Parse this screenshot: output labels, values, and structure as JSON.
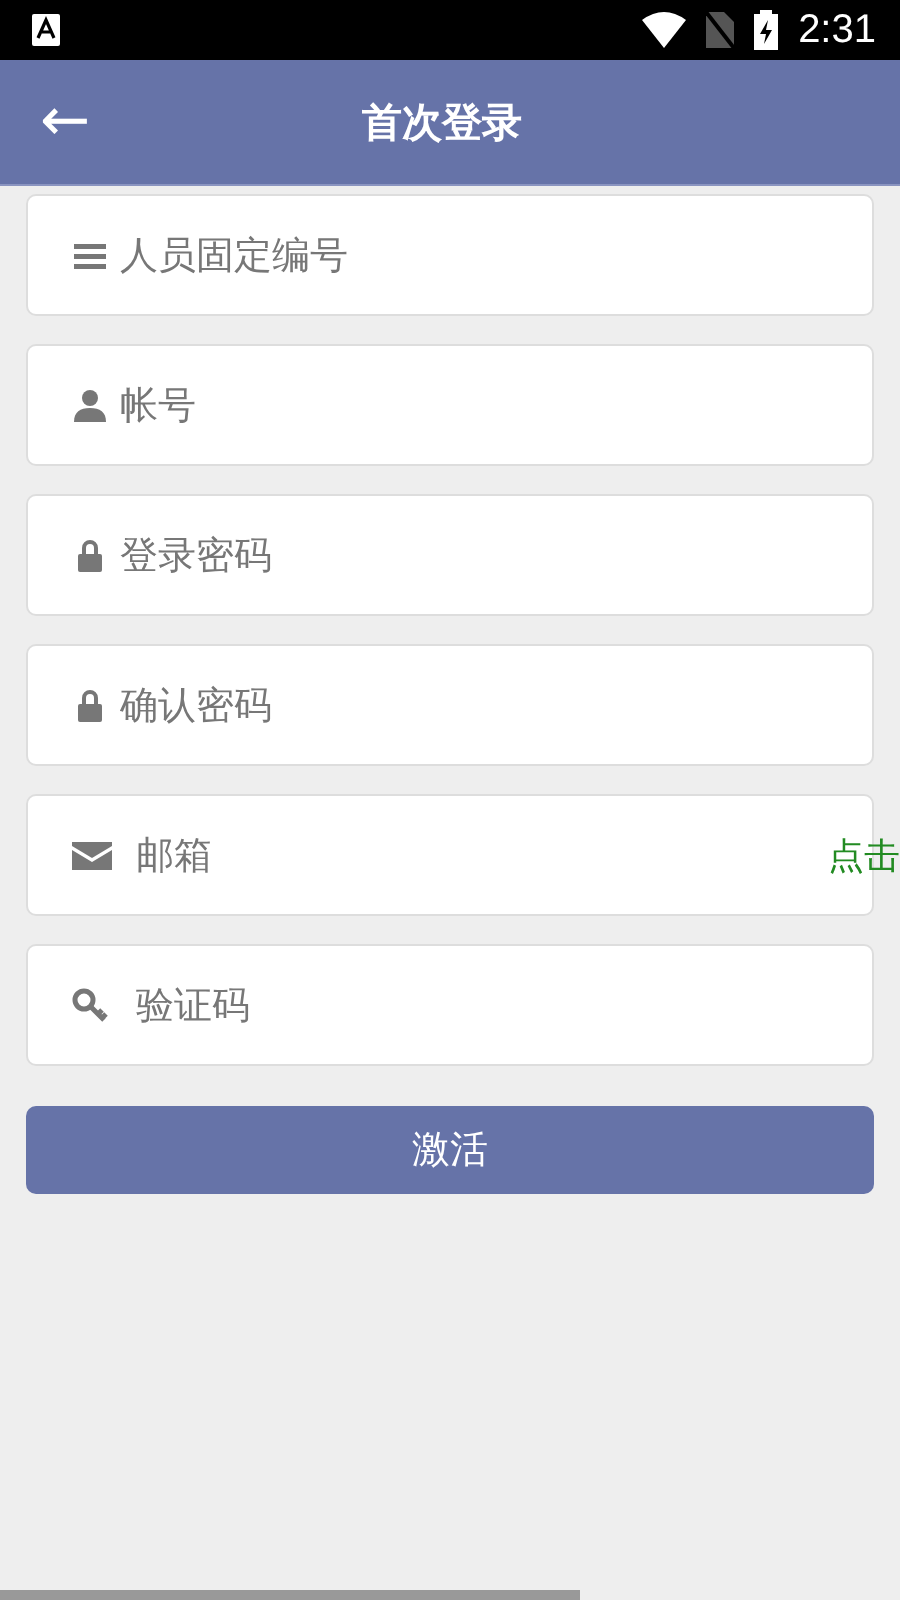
{
  "status_bar": {
    "time": "2:31"
  },
  "app_bar": {
    "back": "←",
    "title": "首次登录"
  },
  "fields": [
    {
      "kind": "staff_id",
      "placeholder": "人员固定编号"
    },
    {
      "kind": "account",
      "placeholder": "帐号"
    },
    {
      "kind": "password",
      "placeholder": "登录密码"
    },
    {
      "kind": "password",
      "placeholder": "确认密码"
    },
    {
      "kind": "email",
      "placeholder": "邮箱",
      "action": "点击"
    },
    {
      "kind": "code",
      "placeholder": "验证码"
    }
  ],
  "submit": {
    "label": "激活"
  }
}
